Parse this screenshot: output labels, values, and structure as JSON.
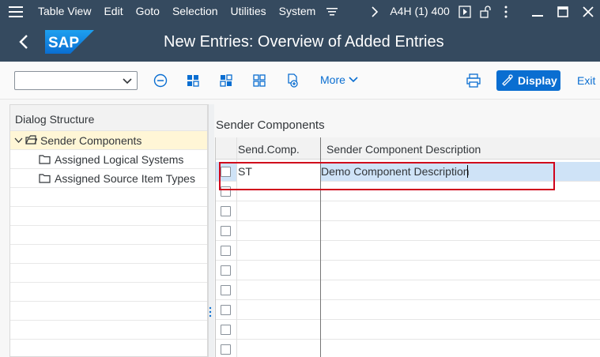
{
  "menubar": {
    "items": [
      "Table View",
      "Edit",
      "Goto",
      "Selection",
      "Utilities",
      "System"
    ],
    "system_name": "A4H (1) 400"
  },
  "titlebar": {
    "logo_text": "SAP",
    "title": "New Entries: Overview of Added Entries"
  },
  "toolbar": {
    "command_field_value": "",
    "more_label": "More",
    "display_label": "Display",
    "exit_label": "Exit"
  },
  "dialog_structure": {
    "header": "Dialog Structure",
    "items": [
      {
        "label": "Sender Components",
        "level": 0,
        "selected": true
      },
      {
        "label": "Assigned Logical Systems",
        "level": 1
      },
      {
        "label": "Assigned Source Item Types",
        "level": 1
      }
    ]
  },
  "table": {
    "title": "Sender Components",
    "columns": [
      "Send.Comp.",
      "Sender Component Description"
    ],
    "rows": [
      {
        "comp": "ST",
        "desc": "Demo Component Description"
      },
      {
        "comp": "",
        "desc": ""
      },
      {
        "comp": "",
        "desc": ""
      },
      {
        "comp": "",
        "desc": ""
      },
      {
        "comp": "",
        "desc": ""
      },
      {
        "comp": "",
        "desc": ""
      },
      {
        "comp": "",
        "desc": ""
      },
      {
        "comp": "",
        "desc": ""
      },
      {
        "comp": "",
        "desc": ""
      },
      {
        "comp": "",
        "desc": ""
      }
    ]
  },
  "colors": {
    "shell": "#354a5f",
    "accent": "#0a6ed1",
    "selected_row": "#cfe3f7",
    "highlight": "#d0021b",
    "tree_selected": "#fff6d6"
  }
}
